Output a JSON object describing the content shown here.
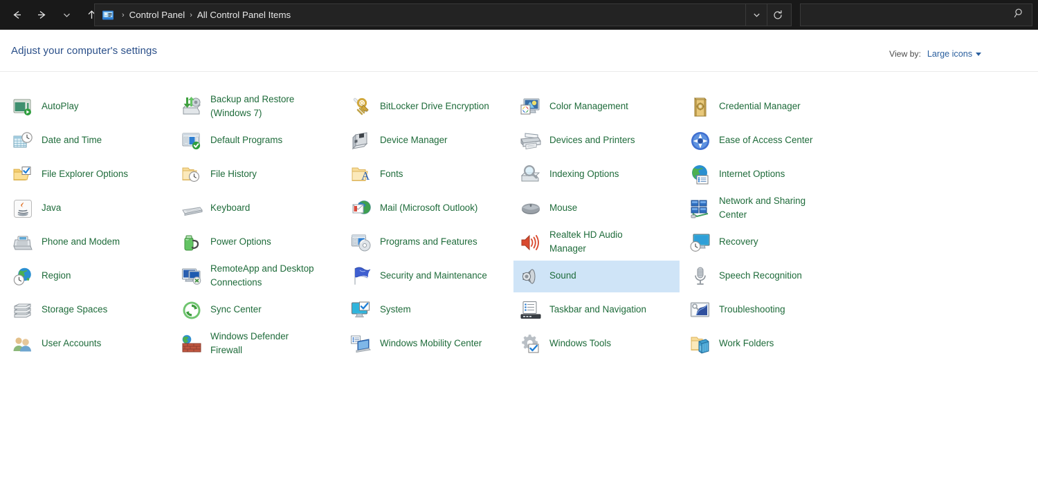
{
  "window": {
    "title": "All Control Panel Items"
  },
  "toolbar": {
    "back_icon": "back-arrow-icon",
    "forward_icon": "forward-arrow-icon",
    "recent_icon": "chevron-down-icon",
    "up_icon": "up-arrow-icon",
    "dropdown_icon": "chevron-down-icon",
    "refresh_icon": "refresh-icon",
    "search_icon": "search-icon"
  },
  "breadcrumb": {
    "icon": "control-panel-icon",
    "separator": "›",
    "items": [
      "Control Panel",
      "All Control Panel Items"
    ]
  },
  "search": {
    "value": "",
    "placeholder": ""
  },
  "header": {
    "title": "Adjust your computer's settings",
    "view_by_label": "View by:",
    "view_by_value": "Large icons"
  },
  "colors": {
    "titlebar_bg": "#191919",
    "page_bg": "#ffffff",
    "title_text": "#2a4f89",
    "item_text": "#1e6b3a",
    "selection_bg": "#cfe4f7",
    "link_blue": "#2a5f9e"
  },
  "items": [
    {
      "label": "AutoPlay",
      "icon": "autoplay-icon",
      "col": 0,
      "row": 0,
      "selected": false
    },
    {
      "label": "Date and Time",
      "icon": "date-and-time-icon",
      "col": 0,
      "row": 1,
      "selected": false
    },
    {
      "label": "File Explorer Options",
      "icon": "file-explorer-options-icon",
      "col": 0,
      "row": 2,
      "selected": false
    },
    {
      "label": "Java",
      "icon": "java-icon",
      "col": 0,
      "row": 3,
      "selected": false
    },
    {
      "label": "Phone and Modem",
      "icon": "phone-and-modem-icon",
      "col": 0,
      "row": 4,
      "selected": false
    },
    {
      "label": "Region",
      "icon": "region-icon",
      "col": 0,
      "row": 5,
      "selected": false
    },
    {
      "label": "Storage Spaces",
      "icon": "storage-spaces-icon",
      "col": 0,
      "row": 6,
      "selected": false
    },
    {
      "label": "User Accounts",
      "icon": "user-accounts-icon",
      "col": 0,
      "row": 7,
      "selected": false
    },
    {
      "label": "Backup and Restore\n(Windows 7)",
      "icon": "backup-and-restore-icon",
      "col": 1,
      "row": 0,
      "selected": false,
      "two_line": true
    },
    {
      "label": "Default Programs",
      "icon": "default-programs-icon",
      "col": 1,
      "row": 1,
      "selected": false
    },
    {
      "label": "File History",
      "icon": "file-history-icon",
      "col": 1,
      "row": 2,
      "selected": false
    },
    {
      "label": "Keyboard",
      "icon": "keyboard-icon",
      "col": 1,
      "row": 3,
      "selected": false
    },
    {
      "label": "Power Options",
      "icon": "power-options-icon",
      "col": 1,
      "row": 4,
      "selected": false
    },
    {
      "label": "RemoteApp and Desktop\nConnections",
      "icon": "remoteapp-icon",
      "col": 1,
      "row": 5,
      "selected": false,
      "two_line": true
    },
    {
      "label": "Sync Center",
      "icon": "sync-center-icon",
      "col": 1,
      "row": 6,
      "selected": false
    },
    {
      "label": "Windows Defender\nFirewall",
      "icon": "windows-defender-firewall-icon",
      "col": 1,
      "row": 7,
      "selected": false,
      "two_line": true
    },
    {
      "label": "BitLocker Drive Encryption",
      "icon": "bitlocker-icon",
      "col": 2,
      "row": 0,
      "selected": false
    },
    {
      "label": "Device Manager",
      "icon": "device-manager-icon",
      "col": 2,
      "row": 1,
      "selected": false
    },
    {
      "label": "Fonts",
      "icon": "fonts-icon",
      "col": 2,
      "row": 2,
      "selected": false
    },
    {
      "label": "Mail (Microsoft Outlook)",
      "icon": "mail-icon",
      "col": 2,
      "row": 3,
      "selected": false
    },
    {
      "label": "Programs and Features",
      "icon": "programs-and-features-icon",
      "col": 2,
      "row": 4,
      "selected": false
    },
    {
      "label": "Security and Maintenance",
      "icon": "security-and-maintenance-icon",
      "col": 2,
      "row": 5,
      "selected": false
    },
    {
      "label": "System",
      "icon": "system-icon",
      "col": 2,
      "row": 6,
      "selected": false
    },
    {
      "label": "Windows Mobility Center",
      "icon": "windows-mobility-center-icon",
      "col": 2,
      "row": 7,
      "selected": false
    },
    {
      "label": "Color Management",
      "icon": "color-management-icon",
      "col": 3,
      "row": 0,
      "selected": false
    },
    {
      "label": "Devices and Printers",
      "icon": "devices-and-printers-icon",
      "col": 3,
      "row": 1,
      "selected": false
    },
    {
      "label": "Indexing Options",
      "icon": "indexing-options-icon",
      "col": 3,
      "row": 2,
      "selected": false
    },
    {
      "label": "Mouse",
      "icon": "mouse-icon",
      "col": 3,
      "row": 3,
      "selected": false
    },
    {
      "label": "Realtek HD Audio\nManager",
      "icon": "realtek-hd-audio-icon",
      "col": 3,
      "row": 4,
      "selected": false,
      "two_line": true
    },
    {
      "label": "Sound",
      "icon": "sound-icon",
      "col": 3,
      "row": 5,
      "selected": true
    },
    {
      "label": "Taskbar and Navigation",
      "icon": "taskbar-and-navigation-icon",
      "col": 3,
      "row": 6,
      "selected": false
    },
    {
      "label": "Windows Tools",
      "icon": "windows-tools-icon",
      "col": 3,
      "row": 7,
      "selected": false
    },
    {
      "label": "Credential Manager",
      "icon": "credential-manager-icon",
      "col": 4,
      "row": 0,
      "selected": false
    },
    {
      "label": "Ease of Access Center",
      "icon": "ease-of-access-icon",
      "col": 4,
      "row": 1,
      "selected": false
    },
    {
      "label": "Internet Options",
      "icon": "internet-options-icon",
      "col": 4,
      "row": 2,
      "selected": false
    },
    {
      "label": "Network and Sharing\nCenter",
      "icon": "network-and-sharing-icon",
      "col": 4,
      "row": 3,
      "selected": false,
      "two_line": true
    },
    {
      "label": "Recovery",
      "icon": "recovery-icon",
      "col": 4,
      "row": 4,
      "selected": false
    },
    {
      "label": "Speech Recognition",
      "icon": "speech-recognition-icon",
      "col": 4,
      "row": 5,
      "selected": false
    },
    {
      "label": "Troubleshooting",
      "icon": "troubleshooting-icon",
      "col": 4,
      "row": 6,
      "selected": false
    },
    {
      "label": "Work Folders",
      "icon": "work-folders-icon",
      "col": 4,
      "row": 7,
      "selected": false
    }
  ]
}
